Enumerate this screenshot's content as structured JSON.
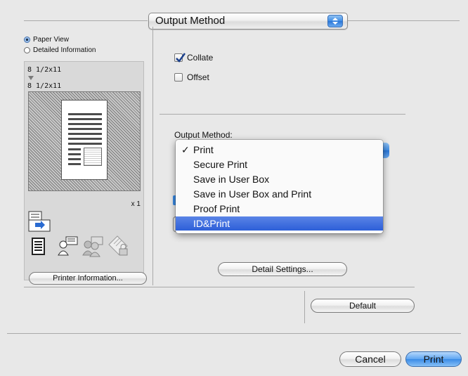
{
  "header": {
    "popup_label": "Output Method"
  },
  "left_panel": {
    "view_options": [
      {
        "label": "Paper View",
        "selected": true
      },
      {
        "label": "Detailed Information",
        "selected": false
      }
    ],
    "paper_size_top": "8 1/2x11",
    "paper_size_bottom": "8 1/2x11",
    "copies": "x 1",
    "printer_info_button": "Printer Information..."
  },
  "options": {
    "collate": {
      "label": "Collate",
      "checked": true
    },
    "offset": {
      "label": "Offset",
      "checked": false
    }
  },
  "output_method": {
    "label": "Output Method:",
    "items": [
      {
        "label": "Print",
        "checked": true,
        "highlighted": false
      },
      {
        "label": "Secure Print",
        "checked": false,
        "highlighted": false
      },
      {
        "label": "Save in User Box",
        "checked": false,
        "highlighted": false
      },
      {
        "label": "Save in User Box and Print",
        "checked": false,
        "highlighted": false
      },
      {
        "label": "Proof Print",
        "checked": false,
        "highlighted": false
      },
      {
        "label": "ID&Print",
        "checked": false,
        "highlighted": true
      }
    ],
    "checkmark": "✓"
  },
  "buttons": {
    "detail_settings": "Detail Settings...",
    "default": "Default",
    "cancel": "Cancel",
    "print": "Print"
  },
  "colors": {
    "accent": "#3a8be6",
    "highlight": "#2d5fd8"
  }
}
